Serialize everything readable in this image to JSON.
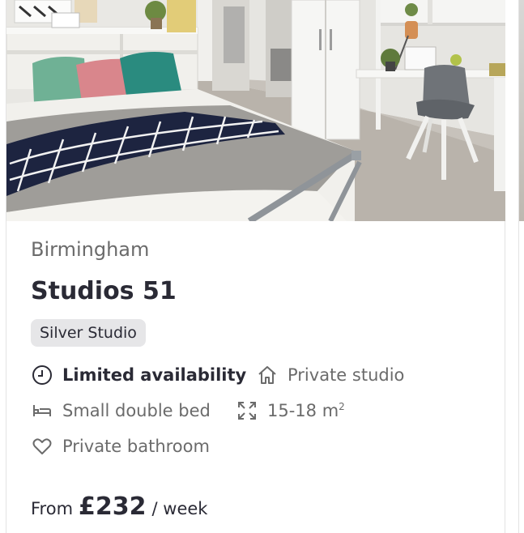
{
  "listing": {
    "city": "Birmingham",
    "name": "Studios 51",
    "room_type": "Silver Studio",
    "features": [
      {
        "icon": "clock-icon",
        "label": "Limited availability",
        "emphasis": true
      },
      {
        "icon": "house-icon",
        "label": "Private studio",
        "emphasis": false
      },
      {
        "icon": "bed-icon",
        "label": "Small double bed",
        "emphasis": false
      },
      {
        "icon": "expand-icon",
        "label": "15-18 m",
        "emphasis": false
      },
      {
        "icon": "heart-icon",
        "label": "Private bathroom",
        "emphasis": false
      }
    ],
    "area_unit_superscript": "2",
    "price": {
      "prefix": "From",
      "amount": "£232",
      "suffix": "/ week"
    }
  },
  "colors": {
    "text_primary": "#2a2a35",
    "text_secondary": "#6b6b6b",
    "badge_bg": "#e6e6e8",
    "border": "#e3e3e3"
  }
}
